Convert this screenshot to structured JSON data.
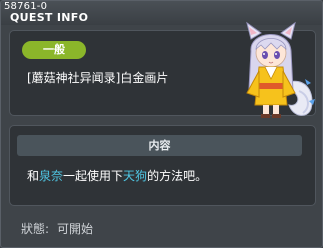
{
  "window": {
    "quest_id": "58761-0",
    "title": "QUEST INFO"
  },
  "quest": {
    "category": "一般",
    "name": "[蘑菇神社异闻录]白金画片"
  },
  "content": {
    "header": "内容",
    "desc_prefix": "和",
    "desc_npc1": "泉奈",
    "desc_mid": "一起使用下",
    "desc_npc2": "天狗",
    "desc_suffix": "的方法吧。"
  },
  "status": {
    "label": "狀態:",
    "value": "可開始"
  },
  "colors": {
    "category_pill": "#8bb62a",
    "highlight": "#4fc6e3",
    "panel": "#2f3337",
    "background": "#3f4449"
  },
  "icons": {
    "npc": "fox-girl-npc-portrait"
  }
}
